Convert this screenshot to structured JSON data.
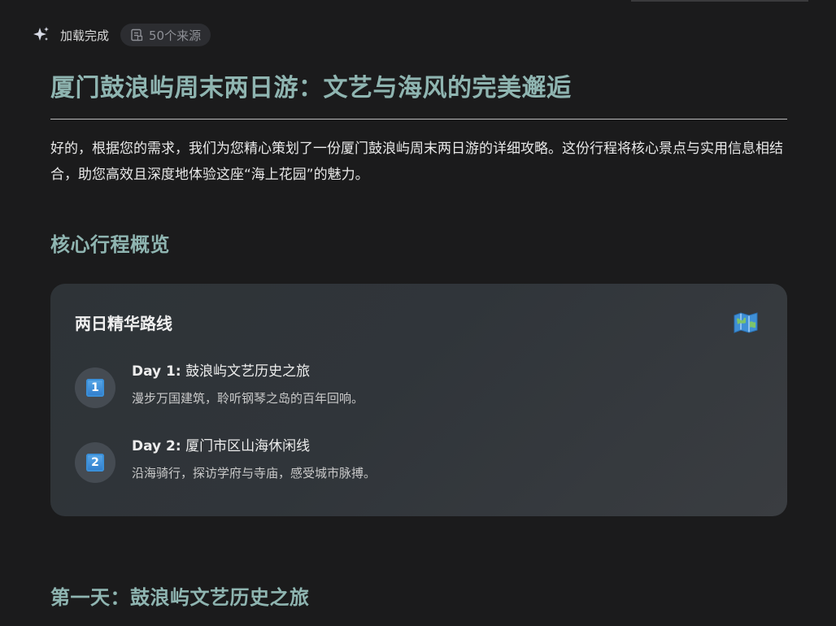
{
  "status": {
    "text": "加载完成",
    "sources_label": "50个来源"
  },
  "article": {
    "title": "厦门鼓浪屿周末两日游：文艺与海风的完美邂逅",
    "intro": "好的，根据您的需求，我们为您精心策划了一份厦门鼓浪屿周末两日游的详细攻略。这份行程将核心景点与实用信息相结合，助您高效且深度地体验这座“海上花园”的魅力。",
    "overview_heading": "核心行程概览",
    "day1_heading": "第一天：鼓浪屿文艺历史之旅"
  },
  "route_card": {
    "title": "两日精华路线",
    "icon": "map-icon",
    "days": [
      {
        "badge": "1",
        "label": "Day 1:",
        "title": "鼓浪屿文艺历史之旅",
        "desc": "漫步万国建筑，聆听钢琴之岛的百年回响。"
      },
      {
        "badge": "2",
        "label": "Day 2:",
        "title": "厦门市区山海休闲线",
        "desc": "沿海骑行，探访学府与寺庙，感受城市脉搏。"
      }
    ]
  },
  "colors": {
    "background": "#1b1b1c",
    "heading": "#8fb5b1",
    "card": "#30353a",
    "pill": "#2c2d31"
  }
}
